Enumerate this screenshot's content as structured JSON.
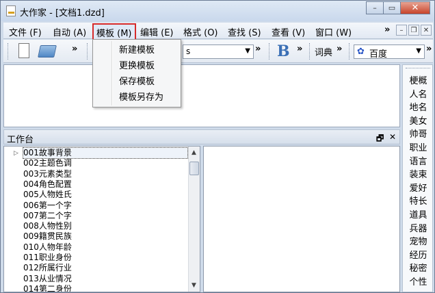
{
  "window": {
    "title": "大作家 - [文档1.dzd]",
    "minimize": "–",
    "restore": "▭",
    "close": "✕"
  },
  "menubar": {
    "items": [
      "文件 (F)",
      "自动 (A)",
      "模板 (M)",
      "编辑 (E)",
      "格式 (O)",
      "查找 (S)",
      "查看 (V)",
      "窗口 (W)"
    ],
    "more": "»",
    "mdi_minimize": "–",
    "mdi_restore": "❐",
    "mdi_close": "✕"
  },
  "template_menu": {
    "items": [
      "新建模板",
      "更换模板",
      "保存模板",
      "模板另存为"
    ]
  },
  "toolbar": {
    "more": "»",
    "font_partial": "s",
    "dict_label": "词典",
    "search_engine": "百度",
    "dropdown_arrow": "▼",
    "bold_label": "B"
  },
  "workbench": {
    "title": "工作台",
    "float_icon": "🗗",
    "close": "✕"
  },
  "tree": {
    "items": [
      "001故事背景",
      "002主题色调",
      "003元素类型",
      "004角色配置",
      "005人物姓氏",
      "006第一个字",
      "007第二个字",
      "008人物性别",
      "009籍贯民族",
      "010人物年龄",
      "011职业身份",
      "012所属行业",
      "013从业情况",
      "014第二身份"
    ],
    "expander": "▷",
    "scroll_up": "▲",
    "scroll_down": "▼"
  },
  "right_panel": {
    "items": [
      "梗概",
      "人名",
      "地名",
      "美女",
      "帅哥",
      "职业",
      "语言",
      "装束",
      "爱好",
      "特长",
      "道具",
      "兵器",
      "宠物",
      "经历",
      "秘密",
      "个性"
    ]
  }
}
